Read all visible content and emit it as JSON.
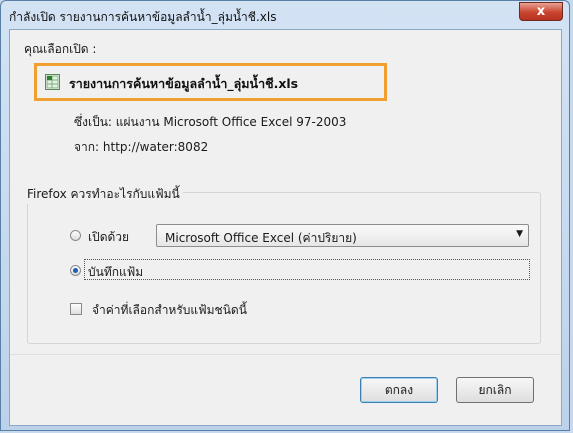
{
  "window": {
    "title": "กำลังเปิด รายงานการค้นหาข้อมูลลำน้ำ_ลุ่มน้ำชี.xls",
    "close_label": "x"
  },
  "file": {
    "you_chose_label": "คุณเลือกเปิด :",
    "name": "รายงานการค้นหาข้อมูลลำน้ำ_ลุ่มน้ำชี.xls",
    "type_text": "ซึ่งเป็น:  แผ่นงาน Microsoft Office Excel 97-2003",
    "from_text": "จาก:  http://water:8082",
    "icon": "excel-file-icon"
  },
  "action_group": {
    "legend": "Firefox ควรทำอะไรกับแฟ้มนี้",
    "open_with_label": "เปิดด้วย",
    "open_with_selected": "Microsoft Office Excel (ค่าปริยาย)",
    "save_label": "บันทึกแฟ้ม",
    "selected_option": "save",
    "remember_label": "จำค่าที่เลือกสำหรับแฟ้มชนิดนี้",
    "remember_checked": false
  },
  "buttons": {
    "ok": "ตกลง",
    "cancel": "ยกเลิก"
  },
  "colors": {
    "highlight_border": "#f0a030",
    "titlebar": "#c6d9ee",
    "close_button": "#c9452f"
  }
}
